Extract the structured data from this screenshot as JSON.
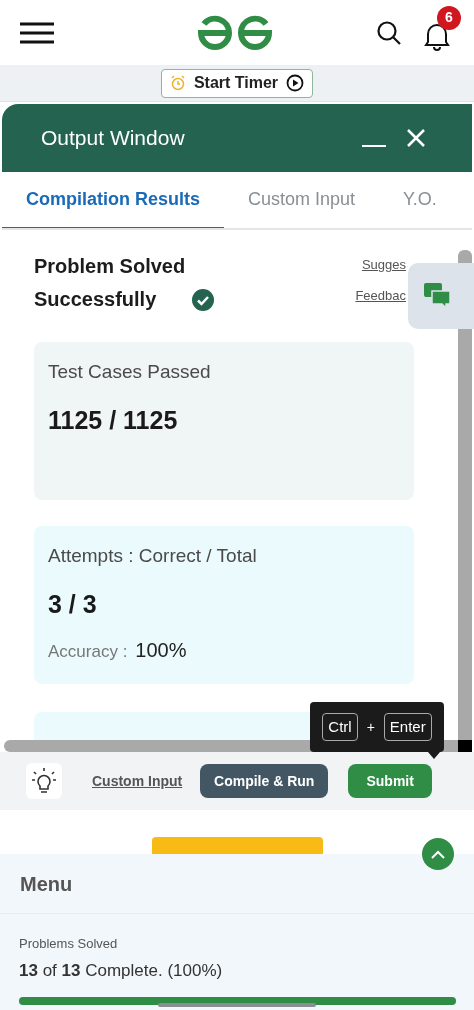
{
  "header": {
    "notifications": "6"
  },
  "timer": {
    "label": "Start Timer"
  },
  "output_window": {
    "title": "Output Window"
  },
  "tabs": [
    {
      "label": "Compilation Results",
      "selected": true
    },
    {
      "label": "Custom Input",
      "selected": false
    },
    {
      "label": "Y.O.",
      "selected": false
    }
  ],
  "result": {
    "title": "Problem Solved Successfully",
    "links": [
      "Sugges",
      "Feedbac"
    ]
  },
  "cards": [
    {
      "label": "Test Cases Passed",
      "value": "1125 / 1125",
      "color": "#f0f6f5"
    },
    {
      "label": "Attempts : Correct / Total",
      "value": "3 / 3",
      "sub_label": "Accuracy :",
      "sub_value": "100%",
      "color": "#ebfbfd"
    }
  ],
  "shortcut": {
    "keys": [
      "Ctrl",
      "Enter"
    ],
    "joiner": "+"
  },
  "actions": {
    "custom_input": "Custom Input",
    "compile": "Compile & Run",
    "submit": "Submit"
  },
  "menu": {
    "title": "Menu",
    "progress_label": "Problems Solved",
    "progress_text": "**13** of **13** Complete. (100%)",
    "level": 1
  }
}
